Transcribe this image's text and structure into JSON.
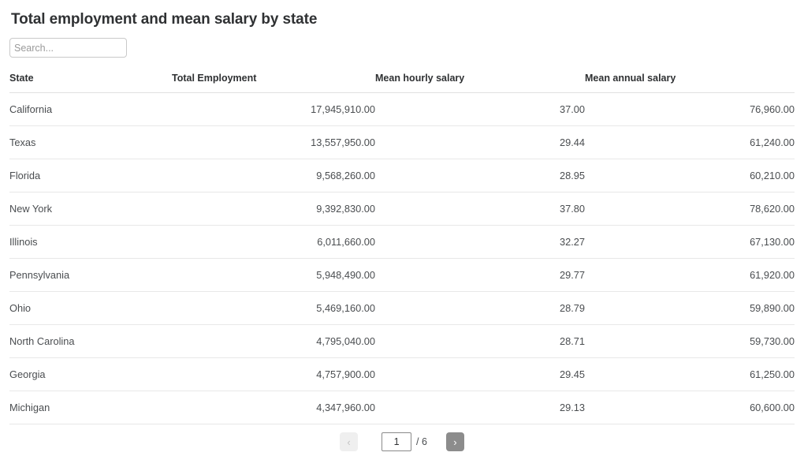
{
  "page": {
    "title": "Total employment and mean salary by state"
  },
  "search": {
    "placeholder": "Search...",
    "value": ""
  },
  "table": {
    "columns": [
      "State",
      "Total Employment",
      "Mean hourly salary",
      "Mean annual salary"
    ],
    "rows": [
      {
        "state": "California",
        "total_employment": "17,945,910.00",
        "mean_hourly_salary": "37.00",
        "mean_annual_salary": "76,960.00"
      },
      {
        "state": "Texas",
        "total_employment": "13,557,950.00",
        "mean_hourly_salary": "29.44",
        "mean_annual_salary": "61,240.00"
      },
      {
        "state": "Florida",
        "total_employment": "9,568,260.00",
        "mean_hourly_salary": "28.95",
        "mean_annual_salary": "60,210.00"
      },
      {
        "state": "New York",
        "total_employment": "9,392,830.00",
        "mean_hourly_salary": "37.80",
        "mean_annual_salary": "78,620.00"
      },
      {
        "state": "Illinois",
        "total_employment": "6,011,660.00",
        "mean_hourly_salary": "32.27",
        "mean_annual_salary": "67,130.00"
      },
      {
        "state": "Pennsylvania",
        "total_employment": "5,948,490.00",
        "mean_hourly_salary": "29.77",
        "mean_annual_salary": "61,920.00"
      },
      {
        "state": "Ohio",
        "total_employment": "5,469,160.00",
        "mean_hourly_salary": "28.79",
        "mean_annual_salary": "59,890.00"
      },
      {
        "state": "North Carolina",
        "total_employment": "4,795,040.00",
        "mean_hourly_salary": "28.71",
        "mean_annual_salary": "59,730.00"
      },
      {
        "state": "Georgia",
        "total_employment": "4,757,900.00",
        "mean_hourly_salary": "29.45",
        "mean_annual_salary": "61,250.00"
      },
      {
        "state": "Michigan",
        "total_employment": "4,347,960.00",
        "mean_hourly_salary": "29.13",
        "mean_annual_salary": "60,600.00"
      }
    ]
  },
  "pagination": {
    "prev_label": "‹",
    "next_label": "›",
    "current_page": "1",
    "total_pages_label": "/ 6"
  }
}
